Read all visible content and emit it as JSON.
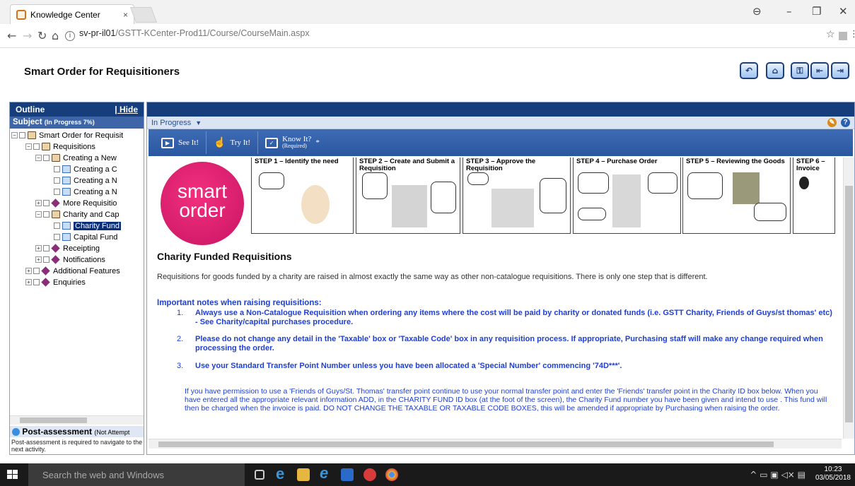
{
  "browser": {
    "tab_title": "Knowledge Center",
    "tab_close": "×",
    "url_host": "sv-pr-il01",
    "url_path": "/GSTT-KCenter-Prod11/Course/CourseMain.aspx",
    "icons": [
      "back-icon",
      "forward-icon",
      "reload-icon",
      "home-icon",
      "info-icon",
      "star-icon",
      "extension-icon",
      "menu-icon"
    ]
  },
  "app": {
    "title": "Smart Order for Requisitioners",
    "header_buttons": [
      "back-icon",
      "home-icon",
      "key-icon",
      "previous-icon",
      "next-icon"
    ]
  },
  "outline": {
    "header": "Outline",
    "hide": "| Hide",
    "subject": "Subject",
    "subject_status": "(In Progress 7%)",
    "tree": [
      {
        "label": "Smart Order for Requisit",
        "icon": "book"
      },
      {
        "label": "Requisitions",
        "icon": "book"
      },
      {
        "label": "Creating a New",
        "icon": "book"
      },
      {
        "label": "Creating a C",
        "icon": "page"
      },
      {
        "label": "Creating a N",
        "icon": "page"
      },
      {
        "label": "Creating a N",
        "icon": "page"
      },
      {
        "label": "More Requisitio",
        "icon": "purple"
      },
      {
        "label": "Charity and Cap",
        "icon": "book"
      },
      {
        "label": "Charity Fund",
        "icon": "page"
      },
      {
        "label": "Capital Fund",
        "icon": "page"
      },
      {
        "label": "Receipting",
        "icon": "purple"
      },
      {
        "label": "Notifications",
        "icon": "purple"
      },
      {
        "label": "Additional Features",
        "icon": "purple"
      },
      {
        "label": "Enquiries",
        "icon": "purple"
      }
    ],
    "post_assessment": "Post-assessment",
    "post_assessment_status": "(Not Attempt",
    "post_note": "Post-assessment is required to navigate to the next activity."
  },
  "main": {
    "progress_label": "In Progress",
    "modes": {
      "see": "See It!",
      "try": "Try It!",
      "know": "Know It?",
      "know_req": "(Required)",
      "know_star": "*"
    },
    "logo": {
      "line1": "smart",
      "line2": "order"
    },
    "steps": [
      {
        "title": "STEP 1 – Identify the need"
      },
      {
        "title": "STEP 2 – Create and Submit a Requisition"
      },
      {
        "title": "STEP 3 – Approve the Requisition"
      },
      {
        "title": "STEP 4 – Purchase Order"
      },
      {
        "title": "STEP 5 – Reviewing the Goods"
      },
      {
        "title": "STEP 6 – Invoice"
      }
    ],
    "heading": "Charity Funded Requisitions",
    "intro": "Requisitions for goods funded by a charity are raised in almost exactly the same way as other non-catalogue requisitions. There is only one step that is different.",
    "notes_heading": "Important notes when raising requisitions:",
    "notes": [
      {
        "num": "1.",
        "text": "Always use a Non-Catalogue Requisition when ordering any items where the cost will be paid by charity or donated funds (i.e. GSTT Charity, Friends of Guys/st thomas' etc) - See Charity/capital purchases procedure."
      },
      {
        "num": "2.",
        "text": "Please do not change any detail in the 'Taxable' box or 'Taxable Code' box in any requisition process.  If appropriate, Purchasing staff will make any change required when processing the order."
      },
      {
        "num": "3.",
        "text": "Use your Standard Transfer Point Number unless you have been allocated a 'Special Number' commencing '74D***'."
      }
    ],
    "paragraph": "If you have permission to use a 'Friends of Guys/St. Thomas' transfer point continue to use your normal transfer point and enter the 'Friends' transfer point in the Charity ID box below.  When you have entered all the appropriate relevant information ADD, in the CHARITY FUND ID box (at the foot of the screen), the Charity Fund number you have been given and intend to use . This fund will then be charged when the invoice is paid. DO NOT CHANGE THE TAXABLE OR TAXABLE CODE BOXES, this will be amended if appropriate by Purchasing when raising the order."
  },
  "taskbar": {
    "search_placeholder": "Search the web and Windows",
    "time": "10:23",
    "date": "03/05/2018"
  }
}
